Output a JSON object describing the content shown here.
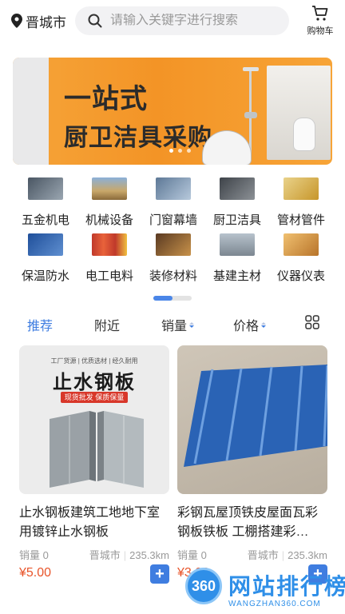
{
  "header": {
    "location": "晋城市",
    "search_placeholder": "请输入关键字进行搜索",
    "cart_label": "购物车"
  },
  "banner": {
    "line1": "一站式",
    "line2": "厨卫洁具采购",
    "slide_count": 3,
    "active_slide": 1
  },
  "categories": [
    {
      "label": "五金机电",
      "color": "#5a6a7a"
    },
    {
      "label": "机械设备",
      "color": "#a58a5a"
    },
    {
      "label": "门窗幕墙",
      "color": "#7a93b0"
    },
    {
      "label": "厨卫洁具",
      "color": "#6b6f74"
    },
    {
      "label": "管材管件",
      "color": "#d9b23a"
    },
    {
      "label": "保温防水",
      "color": "#3b6fb4"
    },
    {
      "label": "电工电料",
      "color": "#c73a2a"
    },
    {
      "label": "装修材料",
      "color": "#8a5a3a"
    },
    {
      "label": "基建主材",
      "color": "#8f9aa5"
    },
    {
      "label": "仪器仪表",
      "color": "#d08a2a"
    }
  ],
  "filters": {
    "recommend": "推荐",
    "nearby": "附近",
    "sales": "销量",
    "price": "价格"
  },
  "products": [
    {
      "title": "止水钢板建筑工地地下室用镀锌止水钢板",
      "sales": "销量 0",
      "city": "晋城市",
      "distance": "235.3km",
      "price": "¥5.00",
      "image_tag": "工厂货源 | 优质选材 | 经久耐用",
      "image_title": "止水钢板",
      "image_badge": "现货批发 保质保量"
    },
    {
      "title": "彩钢瓦屋顶铁皮屋面瓦彩钢板铁板 工棚搭建彩…",
      "sales": "销量 0",
      "city": "晋城市",
      "distance": "235.3km",
      "price": "¥3.00"
    }
  ],
  "watermark": {
    "logo": "360",
    "name": "网站排行榜",
    "url": "WANGZHAN360.COM"
  },
  "colors": {
    "accent": "#3f7de0",
    "price": "#e8542a",
    "banner": "#f39426"
  }
}
